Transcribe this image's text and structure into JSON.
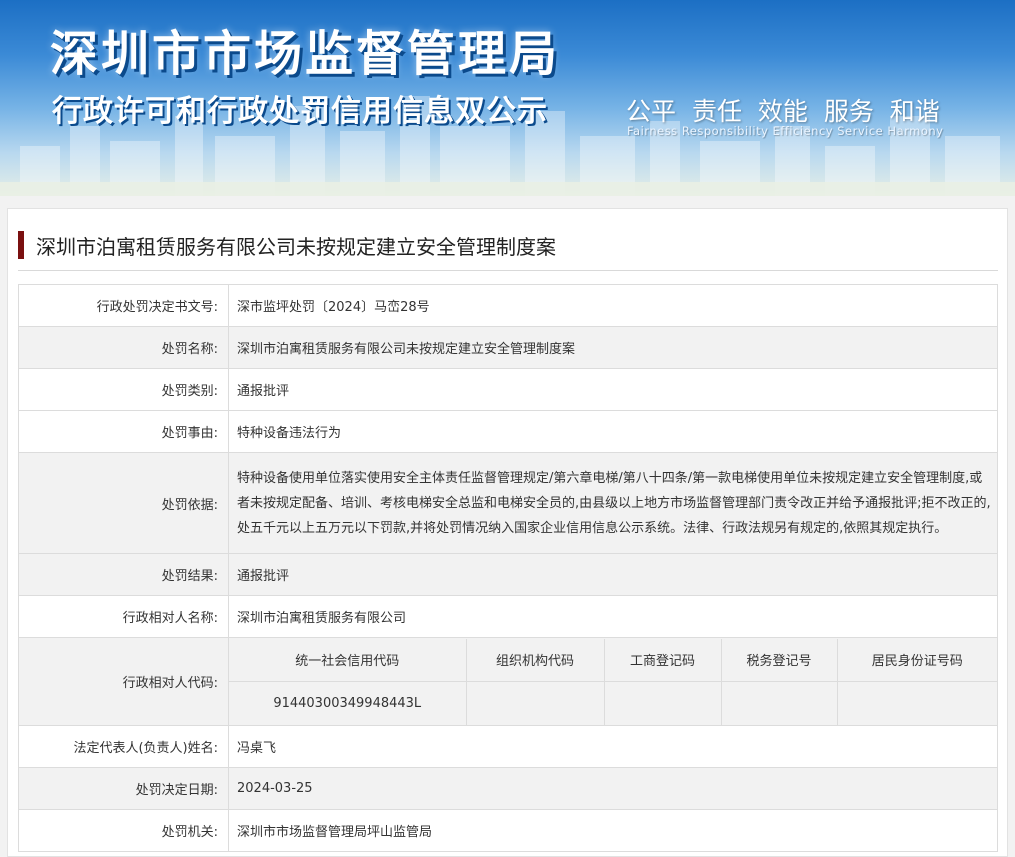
{
  "banner": {
    "title": "深圳市市场监督管理局",
    "subtitle": "行政许可和行政处罚信用信息双公示",
    "slogan": "公平 责任 效能 服务 和谐",
    "slogan_en": "Fairness Responsibility Efficiency Service Harmony"
  },
  "case": {
    "title": "深圳市泊寓租赁服务有限公司未按规定建立安全管理制度案"
  },
  "fields": {
    "doc_no": {
      "label": "行政处罚决定书文号:",
      "value": "深市监坪处罚〔2024〕马峦28号"
    },
    "name": {
      "label": "处罚名称:",
      "value": "深圳市泊寓租赁服务有限公司未按规定建立安全管理制度案"
    },
    "category": {
      "label": "处罚类别:",
      "value": "通报批评"
    },
    "reason": {
      "label": "处罚事由:",
      "value": "特种设备违法行为"
    },
    "basis": {
      "label": "处罚依据:",
      "value": "特种设备使用单位落实使用安全主体责任监督管理规定/第六章电梯/第八十四条/第一款电梯使用单位未按规定建立安全管理制度,或者未按规定配备、培训、考核电梯安全总监和电梯安全员的,由县级以上地方市场监督管理部门责令改正并给予通报批评;拒不改正的,处五千元以上五万元以下罚款,并将处罚情况纳入国家企业信用信息公示系统。法律、行政法规另有规定的,依照其规定执行。"
    },
    "result": {
      "label": "处罚结果:",
      "value": "通报批评"
    },
    "party": {
      "label": "行政相对人名称:",
      "value": "深圳市泊寓租赁服务有限公司"
    },
    "party_code": {
      "label": "行政相对人代码:",
      "headers": [
        "统一社会信用代码",
        "组织机构代码",
        "工商登记码",
        "税务登记号",
        "居民身份证号码"
      ],
      "values": [
        "91440300349948443L",
        "",
        "",
        "",
        ""
      ]
    },
    "legal_rep": {
      "label": "法定代表人(负责人)姓名:",
      "value": "冯桌飞"
    },
    "date": {
      "label": "处罚决定日期:",
      "value": "2024-03-25"
    },
    "authority": {
      "label": "处罚机关:",
      "value": "深圳市市场监督管理局坪山监管局"
    }
  }
}
